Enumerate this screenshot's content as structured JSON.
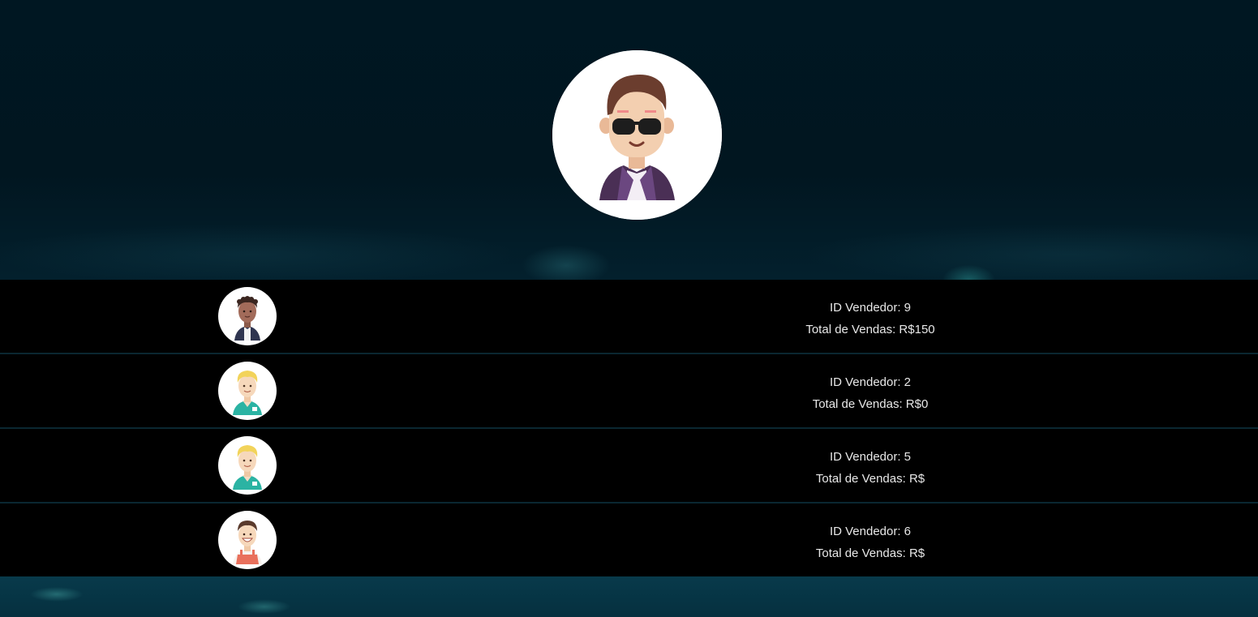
{
  "hero": {
    "avatar_icon": "sunglasses-man-avatar-icon"
  },
  "sellers": [
    {
      "id_label": "ID Vendedor: 9",
      "total_label": "Total de Vendas: R$150",
      "avatar_icon": "man-dark-skin-avatar-icon"
    },
    {
      "id_label": "ID Vendedor: 2",
      "total_label": "Total de Vendas: R$0",
      "avatar_icon": "blond-man-green-shirt-avatar-icon"
    },
    {
      "id_label": "ID Vendedor: 5",
      "total_label": "Total de Vendas: R$",
      "avatar_icon": "blond-man-green-shirt-avatar-icon"
    },
    {
      "id_label": "ID Vendedor: 6",
      "total_label": "Total de Vendas: R$",
      "avatar_icon": "smiling-man-red-apron-avatar-icon"
    }
  ],
  "colors": {
    "background_top": "#001722",
    "background_bottom": "#063546",
    "row_background": "#000000",
    "text": "#e8e8e8"
  }
}
